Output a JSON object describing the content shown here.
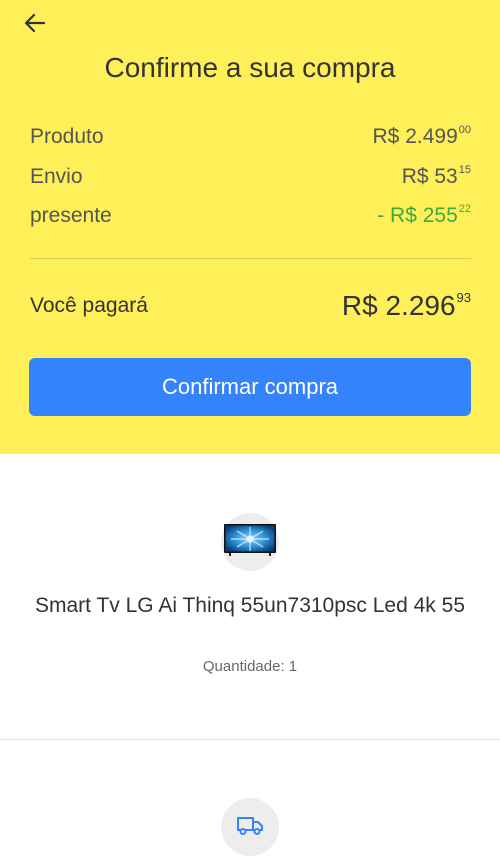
{
  "header": {
    "title": "Confirme a sua compra",
    "back_icon": "arrow-left-icon"
  },
  "summary": {
    "rows": [
      {
        "label": "Produto",
        "value_main": "R$ 2.499",
        "value_cents": "00",
        "color": "#555555"
      },
      {
        "label": "Envio",
        "value_main": "R$ 53",
        "value_cents": "15",
        "color": "#555555"
      },
      {
        "label": "presente",
        "value_main": "- R$ 255",
        "value_cents": "22",
        "color": "#3fa83f"
      }
    ],
    "total_label": "Você pagará",
    "total_main": "R$ 2.296",
    "total_cents": "93"
  },
  "confirm_button": {
    "label": "Confirmar compra",
    "color": "#3483fa"
  },
  "product": {
    "image_icon": "tv-thumbnail-icon",
    "title": "Smart Tv LG Ai Thinq 55un7310psc Led 4k 55",
    "quantity": "Quantidade: 1"
  },
  "shipping": {
    "icon": "truck-icon"
  },
  "colors": {
    "header_bg": "#fff059",
    "accent": "#3483fa",
    "discount": "#3fa83f"
  }
}
